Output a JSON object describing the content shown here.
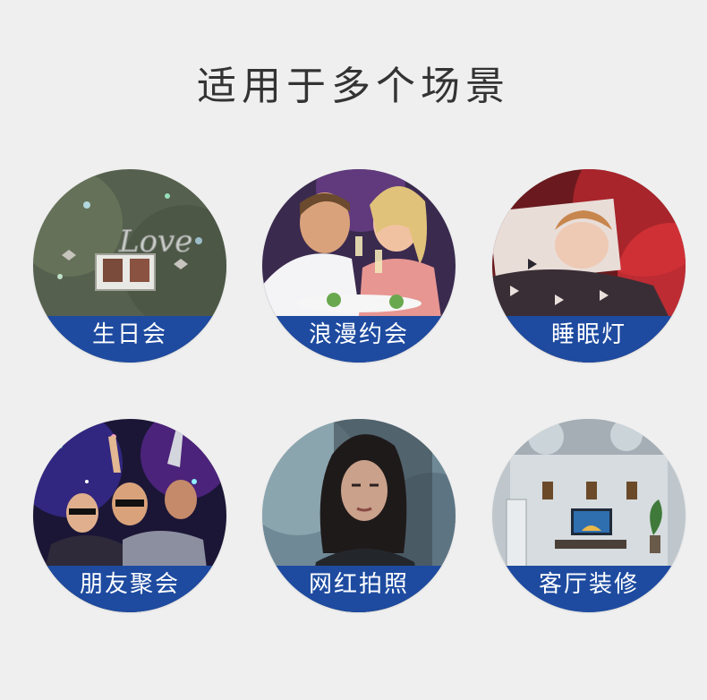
{
  "heading": "适用于多个场景",
  "banner_color": "#1e4ba0",
  "scenes": [
    {
      "label": "生日会"
    },
    {
      "label": "浪漫约会"
    },
    {
      "label": "睡眠灯"
    },
    {
      "label": "朋友聚会"
    },
    {
      "label": "网红拍照"
    },
    {
      "label": "客厅装修"
    }
  ]
}
